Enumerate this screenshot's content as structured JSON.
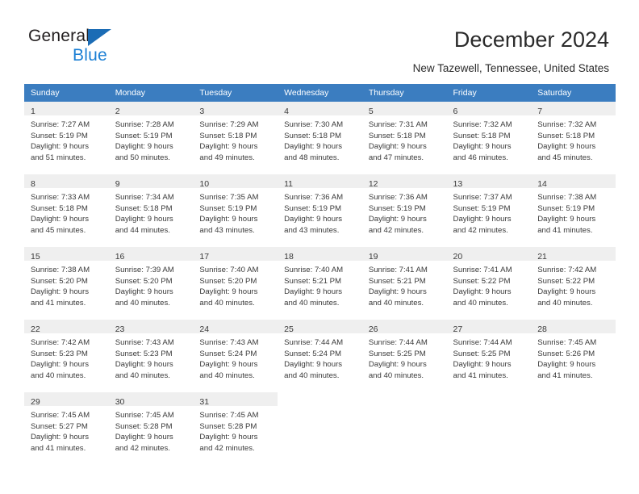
{
  "brand": {
    "name_top": "General",
    "name_bottom": "Blue",
    "triangle_color": "#1b6cb5",
    "blue_color": "#1b7fd4"
  },
  "header": {
    "title": "December 2024",
    "subtitle": "New Tazewell, Tennessee, United States"
  },
  "theme": {
    "header_row_bg": "#3b7dc0",
    "header_row_text": "#ffffff",
    "daynum_bar_bg": "#efefef",
    "body_text": "#3a3a3a"
  },
  "calendar": {
    "weekday_headers": [
      "Sunday",
      "Monday",
      "Tuesday",
      "Wednesday",
      "Thursday",
      "Friday",
      "Saturday"
    ],
    "weeks": [
      [
        {
          "day": "1",
          "sunrise": "Sunrise: 7:27 AM",
          "sunset": "Sunset: 5:19 PM",
          "daylight_line1": "Daylight: 9 hours",
          "daylight_line2": "and 51 minutes."
        },
        {
          "day": "2",
          "sunrise": "Sunrise: 7:28 AM",
          "sunset": "Sunset: 5:19 PM",
          "daylight_line1": "Daylight: 9 hours",
          "daylight_line2": "and 50 minutes."
        },
        {
          "day": "3",
          "sunrise": "Sunrise: 7:29 AM",
          "sunset": "Sunset: 5:18 PM",
          "daylight_line1": "Daylight: 9 hours",
          "daylight_line2": "and 49 minutes."
        },
        {
          "day": "4",
          "sunrise": "Sunrise: 7:30 AM",
          "sunset": "Sunset: 5:18 PM",
          "daylight_line1": "Daylight: 9 hours",
          "daylight_line2": "and 48 minutes."
        },
        {
          "day": "5",
          "sunrise": "Sunrise: 7:31 AM",
          "sunset": "Sunset: 5:18 PM",
          "daylight_line1": "Daylight: 9 hours",
          "daylight_line2": "and 47 minutes."
        },
        {
          "day": "6",
          "sunrise": "Sunrise: 7:32 AM",
          "sunset": "Sunset: 5:18 PM",
          "daylight_line1": "Daylight: 9 hours",
          "daylight_line2": "and 46 minutes."
        },
        {
          "day": "7",
          "sunrise": "Sunrise: 7:32 AM",
          "sunset": "Sunset: 5:18 PM",
          "daylight_line1": "Daylight: 9 hours",
          "daylight_line2": "and 45 minutes."
        }
      ],
      [
        {
          "day": "8",
          "sunrise": "Sunrise: 7:33 AM",
          "sunset": "Sunset: 5:18 PM",
          "daylight_line1": "Daylight: 9 hours",
          "daylight_line2": "and 45 minutes."
        },
        {
          "day": "9",
          "sunrise": "Sunrise: 7:34 AM",
          "sunset": "Sunset: 5:18 PM",
          "daylight_line1": "Daylight: 9 hours",
          "daylight_line2": "and 44 minutes."
        },
        {
          "day": "10",
          "sunrise": "Sunrise: 7:35 AM",
          "sunset": "Sunset: 5:19 PM",
          "daylight_line1": "Daylight: 9 hours",
          "daylight_line2": "and 43 minutes."
        },
        {
          "day": "11",
          "sunrise": "Sunrise: 7:36 AM",
          "sunset": "Sunset: 5:19 PM",
          "daylight_line1": "Daylight: 9 hours",
          "daylight_line2": "and 43 minutes."
        },
        {
          "day": "12",
          "sunrise": "Sunrise: 7:36 AM",
          "sunset": "Sunset: 5:19 PM",
          "daylight_line1": "Daylight: 9 hours",
          "daylight_line2": "and 42 minutes."
        },
        {
          "day": "13",
          "sunrise": "Sunrise: 7:37 AM",
          "sunset": "Sunset: 5:19 PM",
          "daylight_line1": "Daylight: 9 hours",
          "daylight_line2": "and 42 minutes."
        },
        {
          "day": "14",
          "sunrise": "Sunrise: 7:38 AM",
          "sunset": "Sunset: 5:19 PM",
          "daylight_line1": "Daylight: 9 hours",
          "daylight_line2": "and 41 minutes."
        }
      ],
      [
        {
          "day": "15",
          "sunrise": "Sunrise: 7:38 AM",
          "sunset": "Sunset: 5:20 PM",
          "daylight_line1": "Daylight: 9 hours",
          "daylight_line2": "and 41 minutes."
        },
        {
          "day": "16",
          "sunrise": "Sunrise: 7:39 AM",
          "sunset": "Sunset: 5:20 PM",
          "daylight_line1": "Daylight: 9 hours",
          "daylight_line2": "and 40 minutes."
        },
        {
          "day": "17",
          "sunrise": "Sunrise: 7:40 AM",
          "sunset": "Sunset: 5:20 PM",
          "daylight_line1": "Daylight: 9 hours",
          "daylight_line2": "and 40 minutes."
        },
        {
          "day": "18",
          "sunrise": "Sunrise: 7:40 AM",
          "sunset": "Sunset: 5:21 PM",
          "daylight_line1": "Daylight: 9 hours",
          "daylight_line2": "and 40 minutes."
        },
        {
          "day": "19",
          "sunrise": "Sunrise: 7:41 AM",
          "sunset": "Sunset: 5:21 PM",
          "daylight_line1": "Daylight: 9 hours",
          "daylight_line2": "and 40 minutes."
        },
        {
          "day": "20",
          "sunrise": "Sunrise: 7:41 AM",
          "sunset": "Sunset: 5:22 PM",
          "daylight_line1": "Daylight: 9 hours",
          "daylight_line2": "and 40 minutes."
        },
        {
          "day": "21",
          "sunrise": "Sunrise: 7:42 AM",
          "sunset": "Sunset: 5:22 PM",
          "daylight_line1": "Daylight: 9 hours",
          "daylight_line2": "and 40 minutes."
        }
      ],
      [
        {
          "day": "22",
          "sunrise": "Sunrise: 7:42 AM",
          "sunset": "Sunset: 5:23 PM",
          "daylight_line1": "Daylight: 9 hours",
          "daylight_line2": "and 40 minutes."
        },
        {
          "day": "23",
          "sunrise": "Sunrise: 7:43 AM",
          "sunset": "Sunset: 5:23 PM",
          "daylight_line1": "Daylight: 9 hours",
          "daylight_line2": "and 40 minutes."
        },
        {
          "day": "24",
          "sunrise": "Sunrise: 7:43 AM",
          "sunset": "Sunset: 5:24 PM",
          "daylight_line1": "Daylight: 9 hours",
          "daylight_line2": "and 40 minutes."
        },
        {
          "day": "25",
          "sunrise": "Sunrise: 7:44 AM",
          "sunset": "Sunset: 5:24 PM",
          "daylight_line1": "Daylight: 9 hours",
          "daylight_line2": "and 40 minutes."
        },
        {
          "day": "26",
          "sunrise": "Sunrise: 7:44 AM",
          "sunset": "Sunset: 5:25 PM",
          "daylight_line1": "Daylight: 9 hours",
          "daylight_line2": "and 40 minutes."
        },
        {
          "day": "27",
          "sunrise": "Sunrise: 7:44 AM",
          "sunset": "Sunset: 5:25 PM",
          "daylight_line1": "Daylight: 9 hours",
          "daylight_line2": "and 41 minutes."
        },
        {
          "day": "28",
          "sunrise": "Sunrise: 7:45 AM",
          "sunset": "Sunset: 5:26 PM",
          "daylight_line1": "Daylight: 9 hours",
          "daylight_line2": "and 41 minutes."
        }
      ],
      [
        {
          "day": "29",
          "sunrise": "Sunrise: 7:45 AM",
          "sunset": "Sunset: 5:27 PM",
          "daylight_line1": "Daylight: 9 hours",
          "daylight_line2": "and 41 minutes."
        },
        {
          "day": "30",
          "sunrise": "Sunrise: 7:45 AM",
          "sunset": "Sunset: 5:28 PM",
          "daylight_line1": "Daylight: 9 hours",
          "daylight_line2": "and 42 minutes."
        },
        {
          "day": "31",
          "sunrise": "Sunrise: 7:45 AM",
          "sunset": "Sunset: 5:28 PM",
          "daylight_line1": "Daylight: 9 hours",
          "daylight_line2": "and 42 minutes."
        },
        null,
        null,
        null,
        null
      ]
    ]
  }
}
